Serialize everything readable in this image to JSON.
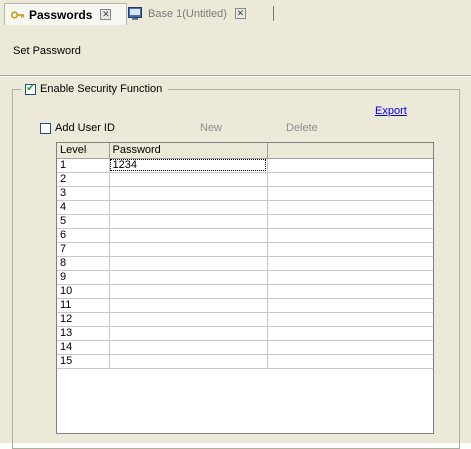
{
  "tabs": [
    {
      "label": "Passwords",
      "active": true,
      "icon": "key-icon"
    },
    {
      "label": "Base 1(Untitled)",
      "active": false,
      "icon": "screen-icon"
    }
  ],
  "panel": {
    "section_label": "Set Password",
    "security_group": {
      "label": "Enable Security Function",
      "checked": true
    },
    "export_label": "Export",
    "add_user_id": {
      "label": "Add User ID",
      "checked": false
    },
    "new_label": "New",
    "delete_label": "Delete"
  },
  "grid": {
    "columns": [
      "Level",
      "Password",
      ""
    ],
    "rows": [
      {
        "level": "1",
        "password": "1234"
      },
      {
        "level": "2",
        "password": ""
      },
      {
        "level": "3",
        "password": ""
      },
      {
        "level": "4",
        "password": ""
      },
      {
        "level": "5",
        "password": ""
      },
      {
        "level": "6",
        "password": ""
      },
      {
        "level": "7",
        "password": ""
      },
      {
        "level": "8",
        "password": ""
      },
      {
        "level": "9",
        "password": ""
      },
      {
        "level": "10",
        "password": ""
      },
      {
        "level": "11",
        "password": ""
      },
      {
        "level": "12",
        "password": ""
      },
      {
        "level": "13",
        "password": ""
      },
      {
        "level": "14",
        "password": ""
      },
      {
        "level": "15",
        "password": ""
      }
    ]
  },
  "colors": {
    "panel_bg": "#ece9d8",
    "link": "#0000ee",
    "check": "#21a121",
    "disabled_text": "#8d8d8d"
  }
}
